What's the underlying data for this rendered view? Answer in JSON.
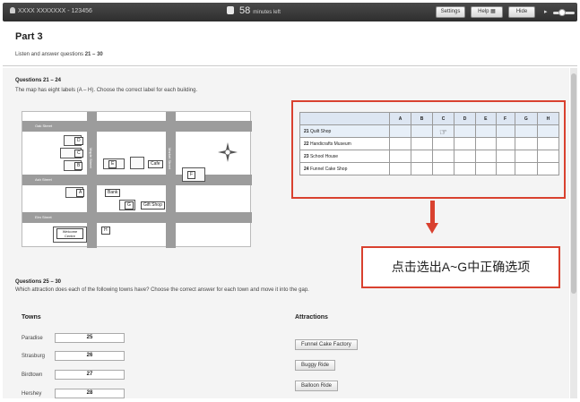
{
  "topbar": {
    "candidate": "XXXX XXXXXXX - 123456",
    "timer": "58",
    "timer_suffix": "minutes left",
    "settings_label": "Settings",
    "help_label": "Help",
    "hide_label": "Hide"
  },
  "header": {
    "part_title": "Part 3",
    "instruction_pre": "Listen and answer questions ",
    "instruction_range": "21 – 30"
  },
  "q21": {
    "title": "Questions 21 – 24",
    "instruction": "The map has eight labels (A – H). Choose the correct label for each building."
  },
  "map": {
    "streets": [
      "Oak Street",
      "Ash Street",
      "Elm Street",
      "Maple Street",
      "Market Street"
    ],
    "labels": [
      "D",
      "C",
      "B",
      "A",
      "E",
      "F",
      "H",
      "G"
    ],
    "places": [
      "Cafe",
      "Bank",
      "Gift Shop",
      "Welcome Centre"
    ],
    "compass": {
      "n": "N",
      "s": "S",
      "e": "E",
      "w": "W"
    }
  },
  "grid": {
    "columns": [
      "A",
      "B",
      "C",
      "D",
      "E",
      "F",
      "G",
      "H"
    ],
    "rows": [
      {
        "num": "21",
        "name": "Quilt Shop"
      },
      {
        "num": "22",
        "name": "Handicrafts Museum"
      },
      {
        "num": "23",
        "name": "School House"
      },
      {
        "num": "24",
        "name": "Funnel Cake Shop"
      }
    ]
  },
  "callout": "点击选出A~G中正确选项",
  "q25": {
    "title": "Questions 25 – 30",
    "instruction": "Which attraction does each of the following towns have? Choose the correct answer for each town and move it into the gap."
  },
  "towns": {
    "heading": "Towns",
    "items": [
      {
        "name": "Paradise",
        "value": "25"
      },
      {
        "name": "Strasburg",
        "value": "26"
      },
      {
        "name": "Birdtown",
        "value": "27"
      },
      {
        "name": "Hershey",
        "value": "28"
      }
    ]
  },
  "attractions": {
    "heading": "Attractions",
    "items": [
      "Funnel Cake Factory",
      "Buggy Ride",
      "Balloon Ride"
    ]
  },
  "colors": {
    "accent_red": "#d9412f",
    "grid_header": "#dde6f2",
    "topbar": "#3a3a3a"
  }
}
